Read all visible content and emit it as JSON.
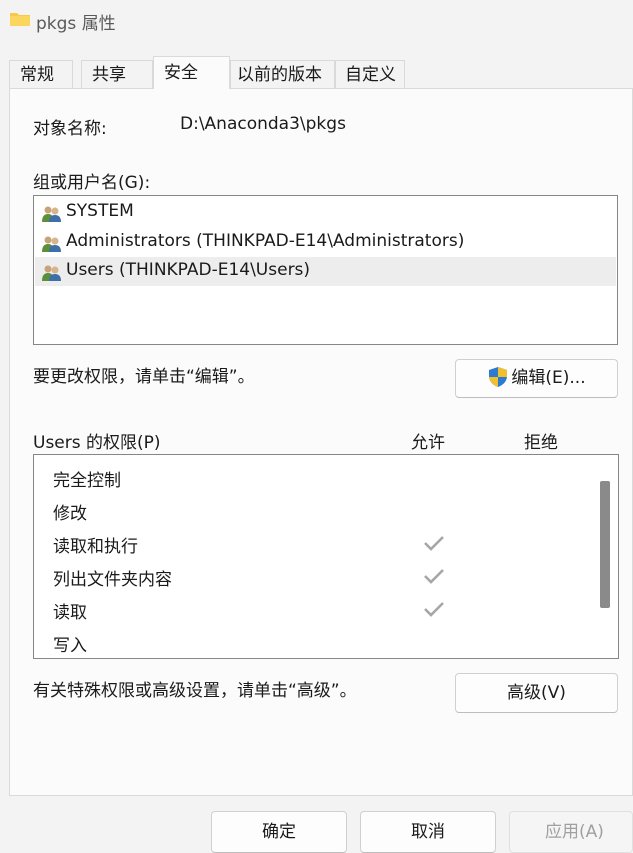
{
  "window": {
    "title": "pkgs 属性"
  },
  "tabs": [
    {
      "label": "常规"
    },
    {
      "label": "共享"
    },
    {
      "label": "安全"
    },
    {
      "label": "以前的版本"
    },
    {
      "label": "自定义"
    }
  ],
  "security": {
    "object_name_label": "对象名称:",
    "object_name_value": "D:\\Anaconda3\\pkgs",
    "groups_label": "组或用户名(G):",
    "groups": [
      {
        "label": "SYSTEM",
        "selected": false
      },
      {
        "label": "Administrators (THINKPAD-E14\\Administrators)",
        "selected": false
      },
      {
        "label": "Users (THINKPAD-E14\\Users)",
        "selected": true
      }
    ],
    "edit_hint": "要更改权限，请单击“编辑”。",
    "edit_button": "编辑(E)...",
    "perm_label": "Users 的权限(P)",
    "allow_header": "允许",
    "deny_header": "拒绝",
    "permissions": [
      {
        "name": "完全控制",
        "allow": false,
        "deny": false
      },
      {
        "name": "修改",
        "allow": false,
        "deny": false
      },
      {
        "name": "读取和执行",
        "allow": true,
        "deny": false
      },
      {
        "name": "列出文件夹内容",
        "allow": true,
        "deny": false
      },
      {
        "name": "读取",
        "allow": true,
        "deny": false
      },
      {
        "name": "写入",
        "allow": false,
        "deny": false
      }
    ],
    "advanced_hint": "有关特殊权限或高级设置，请单击“高级”。",
    "advanced_button": "高级(V)"
  },
  "footer": {
    "ok": "确定",
    "cancel": "取消",
    "apply": "应用(A)"
  },
  "colors": {
    "check": "#a6a6a6",
    "folder": "#f6c94c",
    "shield_blue": "#2b7bd1",
    "shield_yellow": "#f2c02e"
  }
}
